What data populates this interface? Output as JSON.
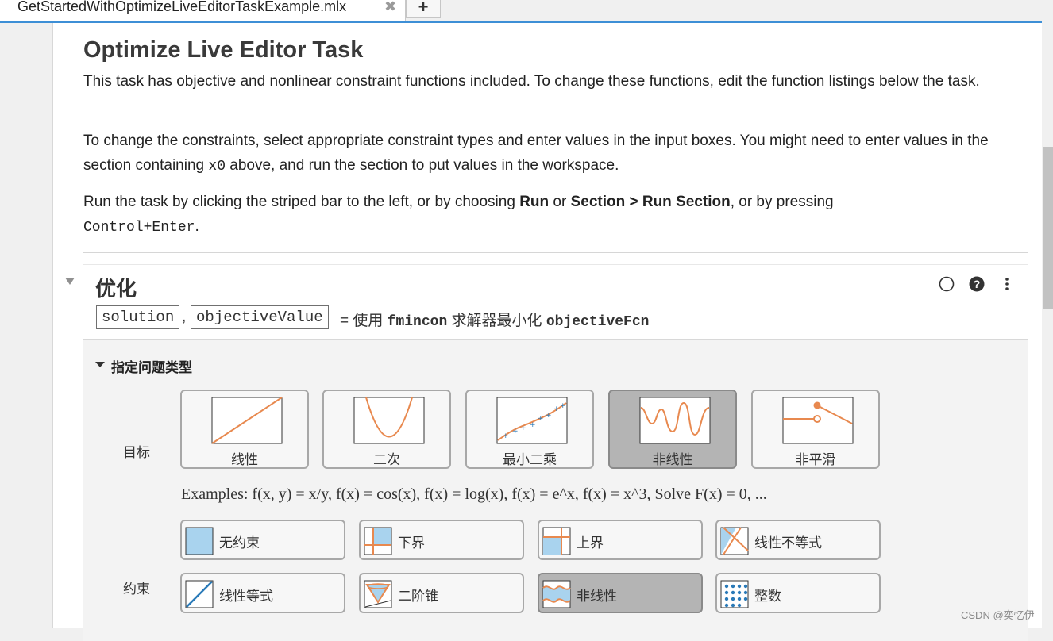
{
  "tab": {
    "title": "GetStartedWithOptimizeLiveEditorTaskExample.mlx",
    "close": "✖",
    "add": "+"
  },
  "doc": {
    "title": "Optimize Live Editor Task",
    "p1": "This task has objective and nonlinear constraint functions included. To change these functions, edit the function listings below the task.",
    "p2a": "To change the constraints, select appropriate constraint types and enter values in the input boxes. You might need to enter values in the section containing ",
    "p2code": "x0",
    "p2b": " above, and run the section to put values in the workspace.",
    "p3a": "Run the task by clicking the striped bar to the left, or by choosing ",
    "p3run": "Run",
    "p3or": " or ",
    "p3sec": "Section > Run Section",
    "p3b": ", or by pressing",
    "p3code": "Control+Enter",
    "p3end": "."
  },
  "task": {
    "title": "优化",
    "out1": "solution",
    "comma": ",",
    "out2": "objectiveValue",
    "desc_a": "=  使用 ",
    "solver": "fmincon",
    "desc_b": " 求解器最小化 ",
    "fcn": "objectiveFcn",
    "icons": [
      "circle-outline-icon",
      "help-icon",
      "more-options-icon"
    ]
  },
  "problem": {
    "section": "指定问题类型",
    "objective_label": "目标",
    "objectives": [
      {
        "label": "线性",
        "selected": false
      },
      {
        "label": "二次",
        "selected": false
      },
      {
        "label": "最小二乘",
        "selected": false
      },
      {
        "label": "非线性",
        "selected": true
      },
      {
        "label": "非平滑",
        "selected": false
      }
    ],
    "examples": "Examples: f(x, y) = x/y, f(x) = cos(x), f(x) = log(x), f(x) = e^x, f(x) = x^3, Solve F(x) = 0, ...",
    "constraint_label": "约束",
    "constraints": [
      {
        "label": "无约束",
        "selected": false
      },
      {
        "label": "下界",
        "selected": false
      },
      {
        "label": "上界",
        "selected": false
      },
      {
        "label": "线性不等式",
        "selected": false
      },
      {
        "label": "线性等式",
        "selected": false
      },
      {
        "label": "二阶锥",
        "selected": false
      },
      {
        "label": "非线性",
        "selected": true
      },
      {
        "label": "整数",
        "selected": false
      }
    ]
  },
  "watermark": "CSDN @奕忆伊",
  "colors": {
    "accent": "#3d8fd6",
    "curve": "#e8894f",
    "fill": "#a9d3ee",
    "selected": "#b4b4b4"
  }
}
